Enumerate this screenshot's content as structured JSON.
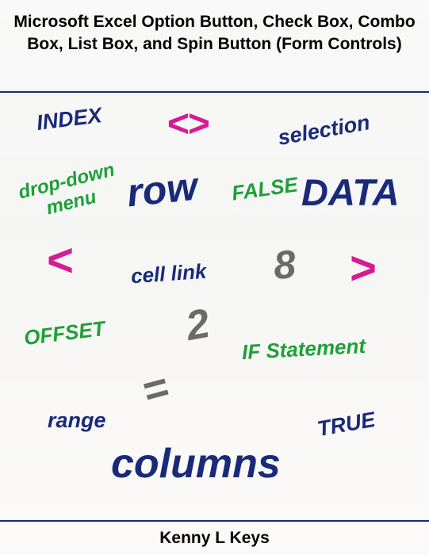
{
  "title": "Microsoft Excel Option Button, Check Box, Combo Box, List Box, and Spin Button (Form Controls)",
  "author": "Kenny L Keys",
  "words": {
    "index": "INDEX",
    "angle_brackets": "<>",
    "selection": "selection",
    "dropdown": "drop-down",
    "menu": "menu",
    "row": "row",
    "false": "FALSE",
    "data": "DATA",
    "lt": "<",
    "cell_link": "cell link",
    "eight": "8",
    "gt": ">",
    "offset": "OFFSET",
    "two": "2",
    "if_stmt": "IF Statement",
    "equals": "=",
    "range": "range",
    "true": "TRUE",
    "columns": "columns"
  }
}
